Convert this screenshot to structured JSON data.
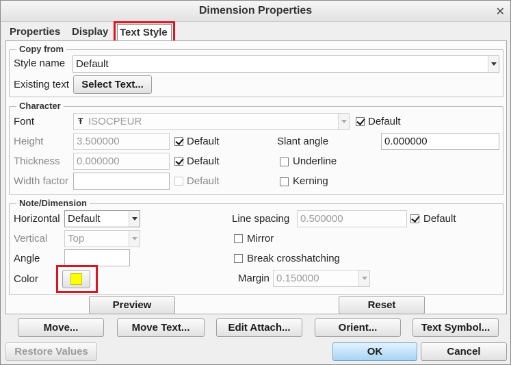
{
  "window": {
    "title": "Dimension Properties"
  },
  "tabs": [
    {
      "label": "Properties"
    },
    {
      "label": "Display"
    },
    {
      "label": "Text Style",
      "active": true
    }
  ],
  "copy_from": {
    "legend": "Copy from",
    "style_name_label": "Style name",
    "style_name_value": "Default",
    "existing_text_label": "Existing text",
    "select_text_button": "Select Text..."
  },
  "character": {
    "legend": "Character",
    "font_label": "Font",
    "font_value": "ISOCPEUR",
    "font_default_label": "Default",
    "font_default_checked": true,
    "height_label": "Height",
    "height_value": "3.500000",
    "height_default_label": "Default",
    "height_default_checked": true,
    "thickness_label": "Thickness",
    "thickness_value": "0.000000",
    "thickness_default_label": "Default",
    "thickness_default_checked": true,
    "width_factor_label": "Width factor",
    "width_factor_value": "",
    "width_default_label": "Default",
    "width_default_checked": false,
    "slant_angle_label": "Slant angle",
    "slant_angle_value": "0.000000",
    "underline_label": "Underline",
    "underline_checked": false,
    "kerning_label": "Kerning",
    "kerning_checked": false
  },
  "note_dimension": {
    "legend": "Note/Dimension",
    "horizontal_label": "Horizontal",
    "horizontal_value": "Default",
    "vertical_label": "Vertical",
    "vertical_value": "Top",
    "angle_label": "Angle",
    "angle_value": "",
    "color_label": "Color",
    "color_value": "#ffff00",
    "line_spacing_label": "Line spacing",
    "line_spacing_value": "0.500000",
    "line_spacing_default_label": "Default",
    "line_spacing_default_checked": true,
    "mirror_label": "Mirror",
    "mirror_checked": false,
    "break_crosshatching_label": "Break crosshatching",
    "break_crosshatching_checked": false,
    "margin_label": "Margin",
    "margin_value": "0.150000"
  },
  "panel_buttons": {
    "preview": "Preview",
    "reset": "Reset"
  },
  "action_buttons": {
    "move": "Move...",
    "move_text": "Move Text...",
    "edit_attach": "Edit Attach...",
    "orient": "Orient...",
    "text_symbol": "Text Symbol..."
  },
  "footer": {
    "restore_values": "Restore Values",
    "ok": "OK",
    "cancel": "Cancel"
  },
  "highlight_color": "#e0141e"
}
